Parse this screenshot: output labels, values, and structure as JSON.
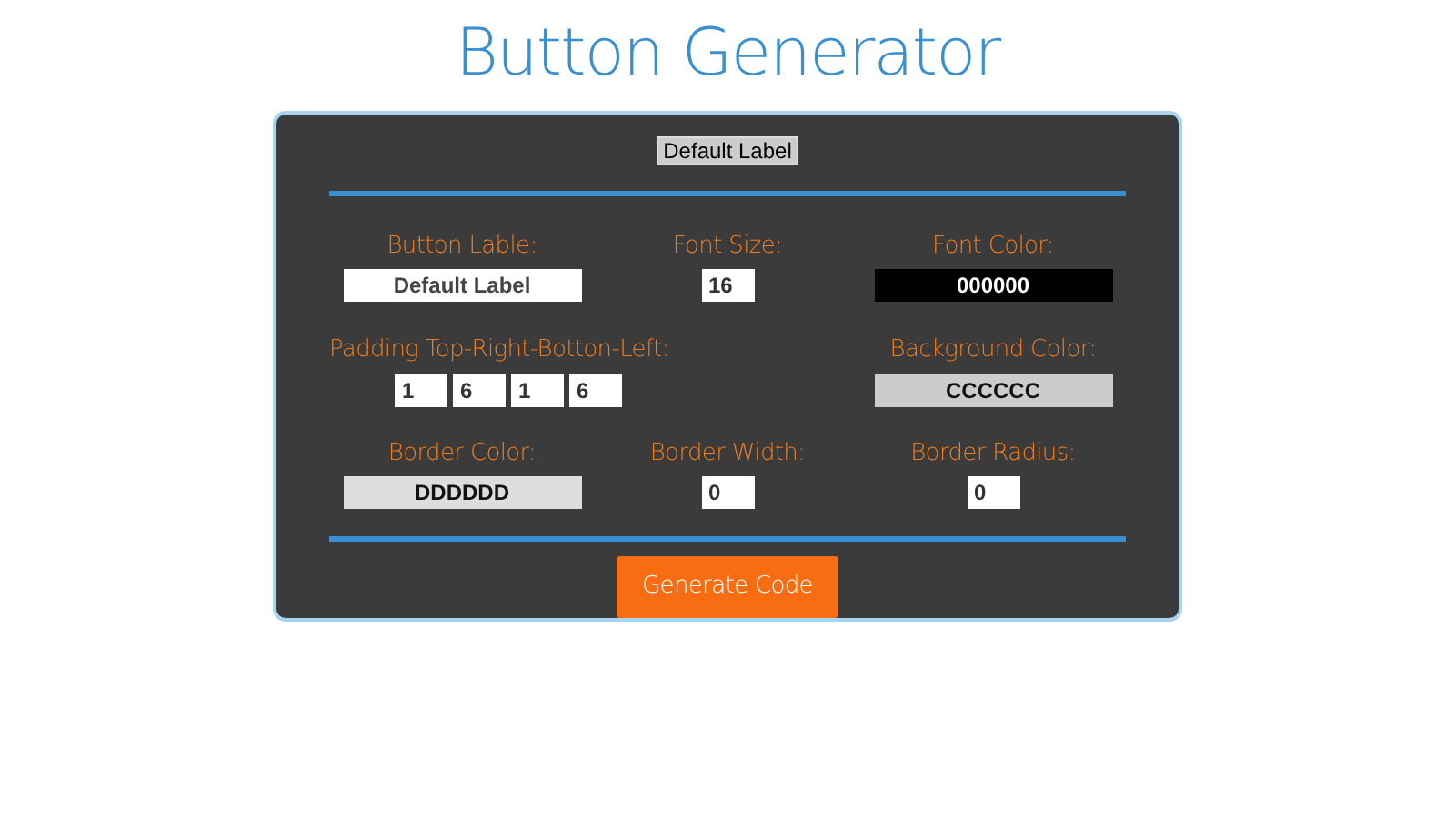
{
  "title": "Button Generator",
  "preview": {
    "label": "Default Label"
  },
  "rows": [
    [
      {
        "label": "Button Lable:",
        "kind": "text",
        "values": [
          "Default Label"
        ]
      },
      {
        "label": "Font Size:",
        "kind": "number",
        "values": [
          "16"
        ]
      },
      {
        "label": "Font Color:",
        "kind": "color",
        "values": [
          "000000"
        ]
      }
    ],
    [
      {
        "label": "Padding Top-Right-Botton-Left:",
        "kind": "multi",
        "values": [
          "1",
          "6",
          "1",
          "6"
        ]
      },
      {
        "label": "Background Color:",
        "kind": "color",
        "values": [
          "CCCCCC"
        ]
      }
    ],
    [
      {
        "label": "Border Color:",
        "kind": "color",
        "values": [
          "DDDDDD"
        ]
      },
      {
        "label": "Border Width:",
        "kind": "number",
        "values": [
          "0"
        ]
      },
      {
        "label": "Border Radius:",
        "kind": "number",
        "values": [
          "0"
        ]
      }
    ]
  ],
  "generate_button": "Generate Code"
}
